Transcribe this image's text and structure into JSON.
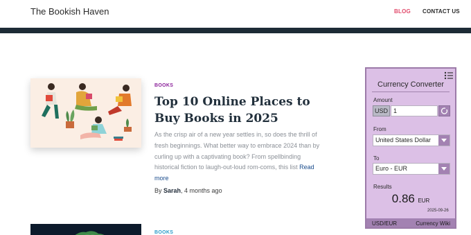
{
  "site": {
    "title": "The Bookish Haven"
  },
  "nav": {
    "blog": "BLOG",
    "contact": "CONTACT US"
  },
  "post1": {
    "category": "BOOKS",
    "title": "Top 10 Online Places to Buy Books in 2025",
    "excerpt": "As the crisp air of a new year settles in, so does the thrill of fresh beginnings. What better way to embrace 2024 than by curling up with a captivating book? From spellbinding historical fiction to laugh-out-loud rom-coms, this list ",
    "read_more": "Read more",
    "by": "By ",
    "author": "Sarah",
    "age": ", 4 months ago"
  },
  "post2": {
    "category": "BOOKS"
  },
  "converter": {
    "title": "Currency Converter",
    "amount_label": "Amount",
    "amount_currency": "USD",
    "amount_value": "1",
    "from_label": "From",
    "from_value": "United States Dollar",
    "to_label": "To",
    "to_value": "Euro - EUR",
    "results_label": "Results",
    "result_value": "0.86",
    "result_unit": "EUR",
    "date": "2025-09-26",
    "footer_pair": "USD/EUR",
    "footer_link": "Currency Wiki"
  },
  "colors": {
    "accent_nav": "#e14a6b",
    "category": "#8a1f9a",
    "widget_bg": "#dcc0e6",
    "widget_accent": "#a382b2",
    "dark_bar": "#1d2b36"
  },
  "icons": {
    "menu": "list-menu-icon",
    "refresh": "refresh-icon",
    "dropdown": "chevron-down-icon"
  }
}
